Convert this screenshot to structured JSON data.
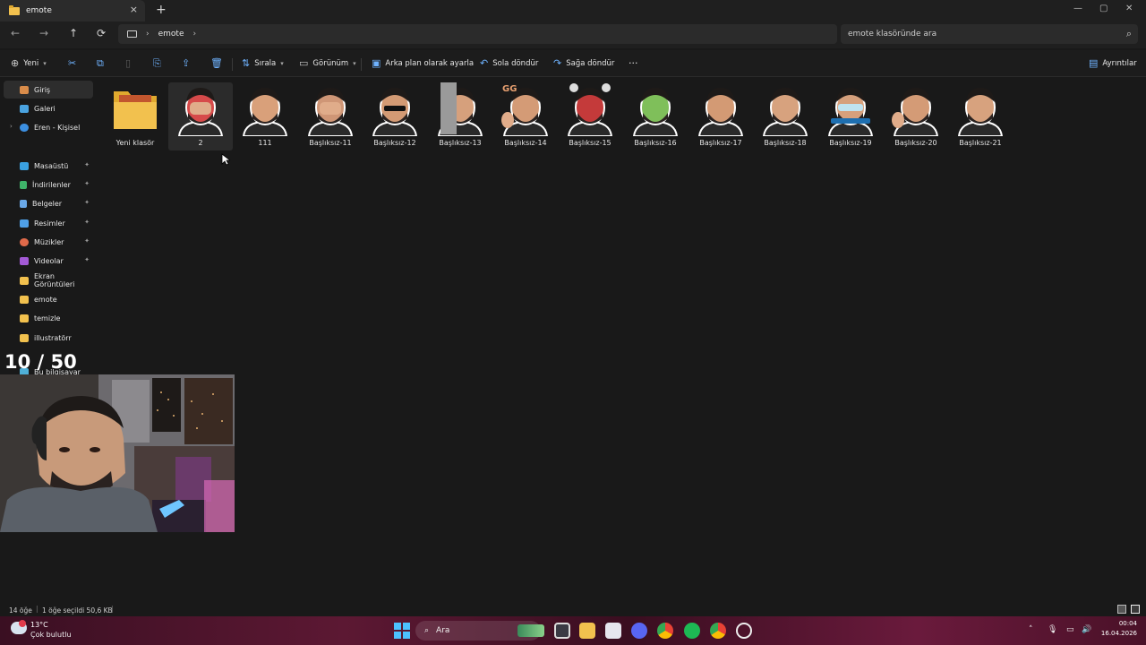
{
  "window": {
    "tab_title": "emote",
    "tab_close": "×",
    "new_tab": "+"
  },
  "window_controls": {
    "minimize": "—",
    "maximize": "▢",
    "close": "✕"
  },
  "nav": {
    "back": "←",
    "forward": "→",
    "up": "↑",
    "refresh": "⟳",
    "breadcrumb_sep1": "›",
    "breadcrumb_folder": "emote",
    "breadcrumb_sep2": "›"
  },
  "search": {
    "placeholder": "emote klasöründe ara"
  },
  "toolbar": {
    "new_label": "Yeni",
    "sort_label": "Sırala",
    "view_label": "Görünüm",
    "set_bg_label": "Arka plan olarak ayarla",
    "rotate_left_label": "Sola döndür",
    "rotate_right_label": "Sağa döndür",
    "more_label": "···",
    "details_label": "Ayrıntılar"
  },
  "sidebar": {
    "items": [
      {
        "label": "Giriş"
      },
      {
        "label": "Galeri"
      },
      {
        "label": "Eren - Kişisel"
      },
      {
        "label": "Masaüstü"
      },
      {
        "label": "İndirilenler"
      },
      {
        "label": "Belgeler"
      },
      {
        "label": "Resimler"
      },
      {
        "label": "Müzikler"
      },
      {
        "label": "Videolar"
      },
      {
        "label": "Ekran Görüntüleri"
      },
      {
        "label": "emote"
      },
      {
        "label": "temizle"
      },
      {
        "label": "illustratörr"
      },
      {
        "label": "Bu bilgisayar"
      }
    ]
  },
  "files": [
    {
      "name": "Yeni klasör",
      "type": "folder"
    },
    {
      "name": "2",
      "type": "emote",
      "variant": "facepalm-red"
    },
    {
      "name": "111",
      "type": "emote",
      "variant": "laugh"
    },
    {
      "name": "Başlıksız-11",
      "type": "emote",
      "variant": "facepalm"
    },
    {
      "name": "Başlıksız-12",
      "type": "emote",
      "variant": "sunglasses"
    },
    {
      "name": "Başlıksız-13",
      "type": "emote",
      "variant": "peek"
    },
    {
      "name": "Başlıksız-14",
      "type": "emote",
      "variant": "thumbs-gg",
      "badge": "GG"
    },
    {
      "name": "Başlıksız-15",
      "type": "emote",
      "variant": "angry"
    },
    {
      "name": "Başlıksız-16",
      "type": "emote",
      "variant": "sick"
    },
    {
      "name": "Başlıksız-17",
      "type": "emote",
      "variant": "think"
    },
    {
      "name": "Başlıksız-18",
      "type": "emote",
      "variant": "sad"
    },
    {
      "name": "Başlıksız-19",
      "type": "emote",
      "variant": "sleep",
      "badge": "SLEEP MASK"
    },
    {
      "name": "Başlıksız-20",
      "type": "emote",
      "variant": "wave"
    },
    {
      "name": "Başlıksız-21",
      "type": "emote",
      "variant": "cry-laugh"
    }
  ],
  "status": {
    "count": "14 öğe",
    "selected": "1 öğe seçildi 50,6 KB"
  },
  "overlay": {
    "counter": "10 / 50"
  },
  "taskbar": {
    "weather_temp": "13°C",
    "weather_desc": "Çok bulutlu",
    "search_placeholder": "Ara",
    "time": "00:04",
    "date": "16.04.2026"
  },
  "colors": {
    "accent": "#6fb3ff",
    "folder": "#f2c14e",
    "taskbar": "#5c1833"
  }
}
